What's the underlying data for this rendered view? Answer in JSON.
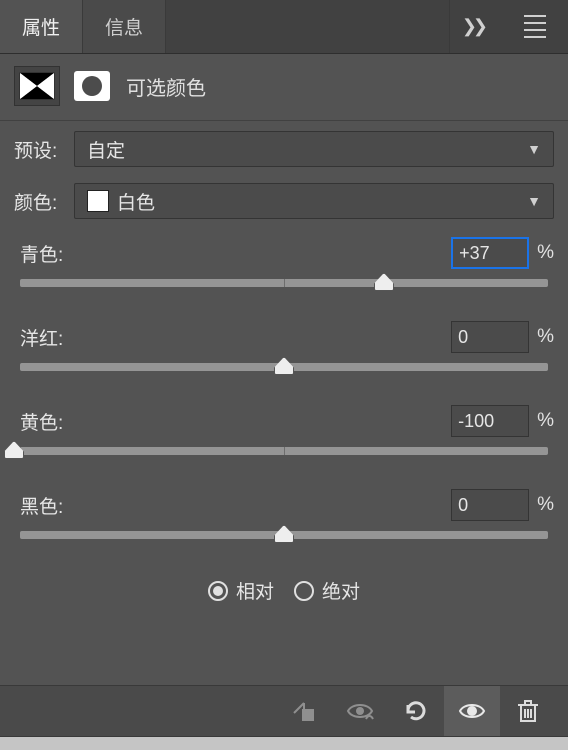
{
  "tabs": {
    "properties": "属性",
    "info": "信息"
  },
  "panel": {
    "title": "可选颜色"
  },
  "preset": {
    "label": "预设:",
    "value": "自定"
  },
  "colors": {
    "label": "颜色:",
    "value": "白色"
  },
  "sliders": {
    "cyan": {
      "label": "青色:",
      "value": "+37",
      "percent_pos": 68.5
    },
    "magenta": {
      "label": "洋红:",
      "value": "0",
      "percent_pos": 50
    },
    "yellow": {
      "label": "黄色:",
      "value": "-100",
      "percent_pos": 0
    },
    "black": {
      "label": "黑色:",
      "value": "0",
      "percent_pos": 50
    }
  },
  "method": {
    "relative": "相对",
    "absolute": "绝对",
    "selected": "relative"
  },
  "unit": "%"
}
